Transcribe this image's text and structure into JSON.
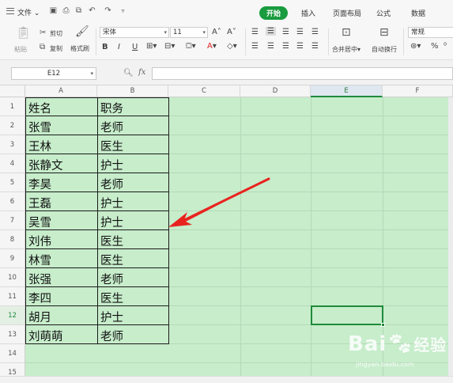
{
  "menu": {
    "file_label": "文件",
    "tabs": [
      {
        "label": "开始",
        "active": true
      },
      {
        "label": "插入",
        "active": false
      },
      {
        "label": "页面布局",
        "active": false
      },
      {
        "label": "公式",
        "active": false
      },
      {
        "label": "数据",
        "active": false
      }
    ],
    "accent_color": "#1a9b3f"
  },
  "ribbon": {
    "paste_label": "粘贴",
    "cut_label": "剪切",
    "copy_label": "复制",
    "format_painter_label": "格式刷",
    "font_name": "宋体",
    "font_size": "11",
    "bold": "B",
    "italic": "I",
    "underline": "U",
    "merge_center_label": "合并居中",
    "wrap_text_label": "自动换行",
    "number_format": "常规",
    "percent": "%"
  },
  "formula_bar": {
    "name_box": "E12",
    "fx_label": "fx",
    "formula": ""
  },
  "grid": {
    "columns": [
      "A",
      "B",
      "C",
      "D",
      "E",
      "F"
    ],
    "selected_column": "E",
    "rows": [
      "1",
      "2",
      "3",
      "4",
      "5",
      "6",
      "7",
      "8",
      "9",
      "10",
      "11",
      "12",
      "13",
      "14",
      "15"
    ],
    "selected_row": "12",
    "sheet_color": "#c7edcb",
    "table": [
      [
        "姓名",
        "职务"
      ],
      [
        "张雪",
        "老师"
      ],
      [
        "王林",
        "医生"
      ],
      [
        "张静文",
        "护士"
      ],
      [
        "李昊",
        "老师"
      ],
      [
        "王磊",
        "护士"
      ],
      [
        "吴雪",
        "护士"
      ],
      [
        "刘伟",
        "医生"
      ],
      [
        "林雪",
        "医生"
      ],
      [
        "张强",
        "老师"
      ],
      [
        "李四",
        "医生"
      ],
      [
        "胡月",
        "护士"
      ],
      [
        "刘萌萌",
        "老师"
      ]
    ],
    "annotation_arrow_color": "#e8231f"
  },
  "watermark": {
    "brand": "Bai",
    "brand_cn": "经验",
    "url": "jingyan.baidu.com"
  }
}
